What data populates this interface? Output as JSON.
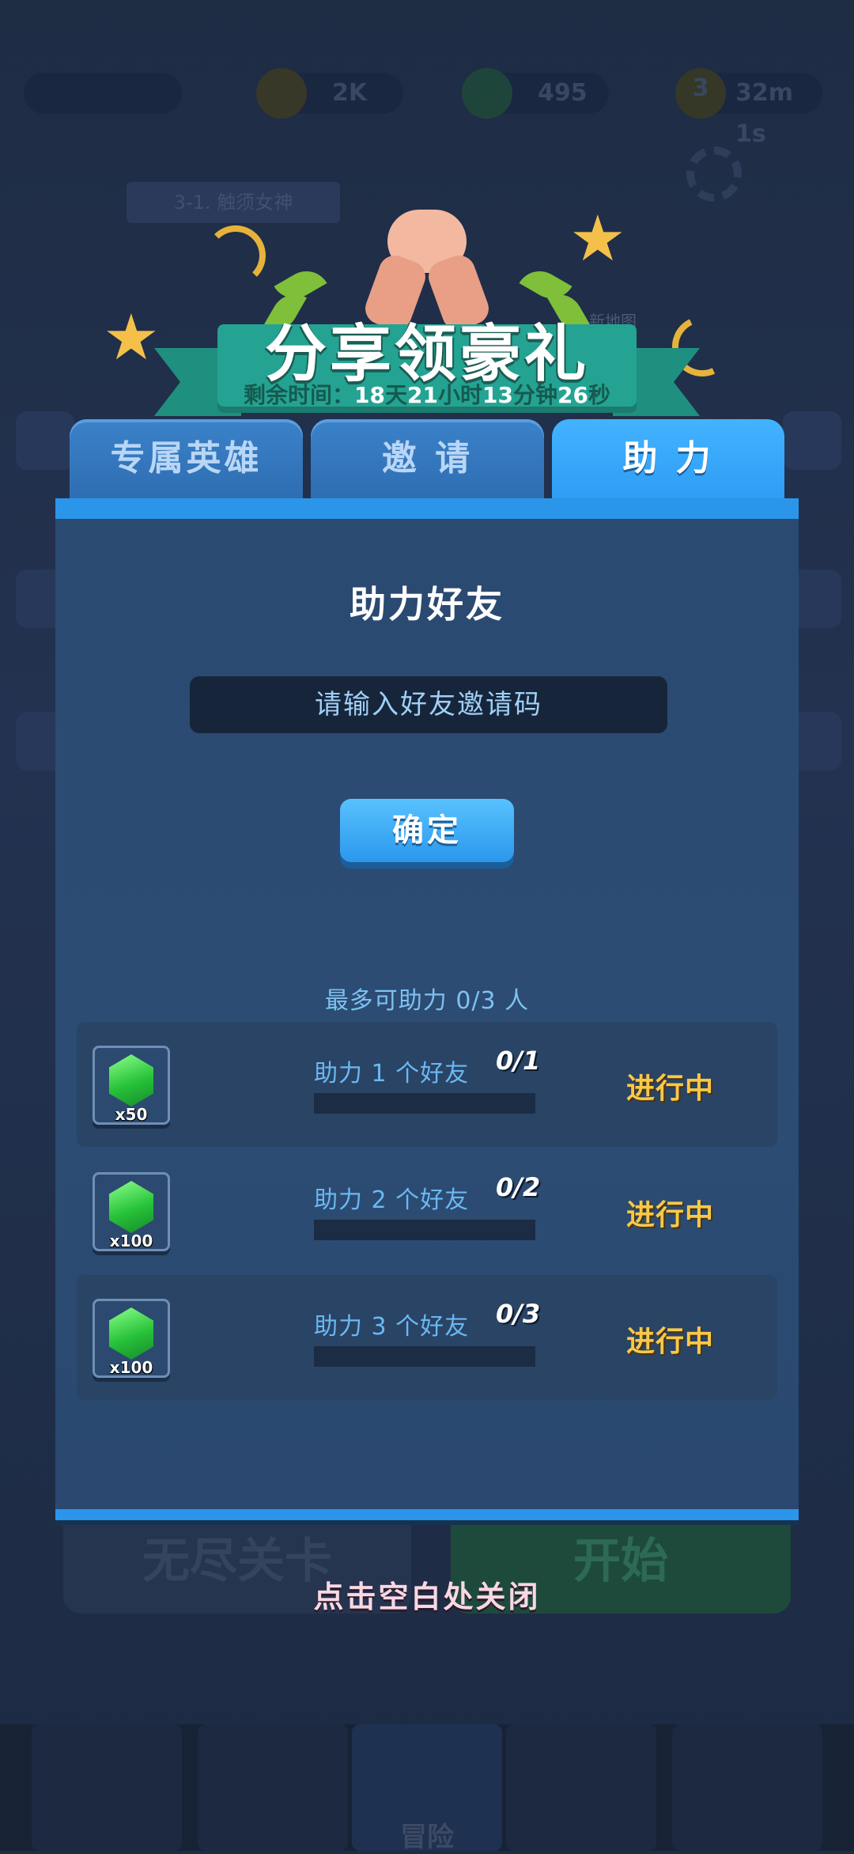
{
  "background": {
    "currencies": [
      {
        "name": "coin",
        "value": "2K"
      },
      {
        "name": "gem",
        "value": "495"
      },
      {
        "name": "energy",
        "value": "32m 1s",
        "count": "3"
      }
    ],
    "stage_label": "3-1. 触须女神",
    "side_label_new_map": "新地图",
    "bottom_buttons": {
      "endless": "无尽关卡",
      "start": "开始"
    },
    "nav_center": "冒险"
  },
  "header": {
    "title": "分享领豪礼",
    "timer_prefix": "剩余时间：",
    "timer": [
      {
        "num": "18",
        "unit": "天"
      },
      {
        "num": "21",
        "unit": "小时"
      },
      {
        "num": "13",
        "unit": "分钟"
      },
      {
        "num": "26",
        "unit": "秒"
      }
    ]
  },
  "tabs": [
    {
      "label": "专属英雄",
      "active": false
    },
    {
      "label": "邀 请",
      "active": false
    },
    {
      "label": "助 力",
      "active": true
    }
  ],
  "panel": {
    "title": "助力好友",
    "input_placeholder": "请输入好友邀请码",
    "confirm_label": "确定",
    "limit_text": "最多可助力 0/3 人"
  },
  "tasks": [
    {
      "reward": "x50",
      "label": "助力 1 个好友",
      "progress": "0/1",
      "fraction": 0,
      "status": "进行中"
    },
    {
      "reward": "x100",
      "label": "助力 2 个好友",
      "progress": "0/2",
      "fraction": 0,
      "status": "进行中"
    },
    {
      "reward": "x100",
      "label": "助力 3 个好友",
      "progress": "0/3",
      "fraction": 0,
      "status": "进行中"
    }
  ],
  "close_hint": "点击空白处关闭",
  "colors": {
    "panel": "#2b4a72",
    "accent_blue": "#2b95ea",
    "status_yellow": "#f7c948",
    "gem_green": "#27c23a",
    "ribbon_teal": "#24a392"
  }
}
